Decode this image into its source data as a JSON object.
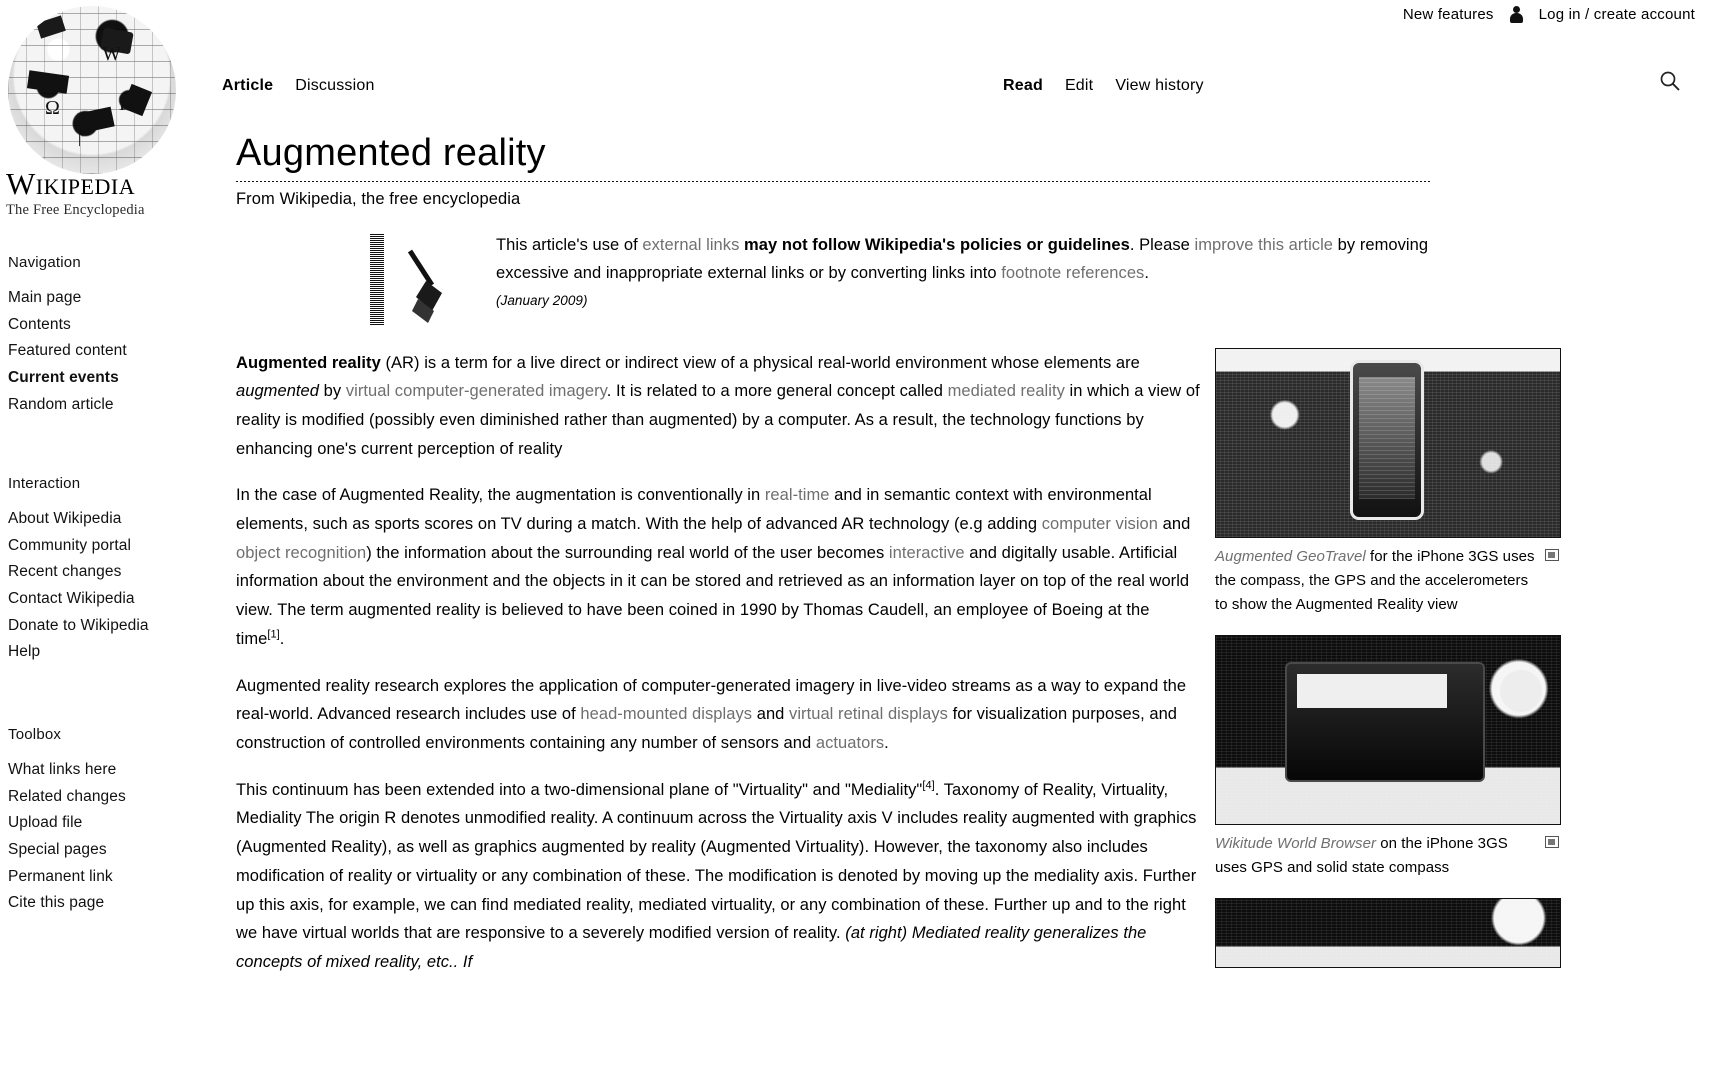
{
  "personal_bar": {
    "items": [
      {
        "label": "New features",
        "icon": null
      },
      {
        "label": "Log in / create account",
        "icon": "user-icon"
      }
    ]
  },
  "sidebar": {
    "logo_word_primary": "W",
    "logo_word_rest": "IKIPEDIA",
    "tagline": "The Free Encyclopedia",
    "sections": [
      {
        "heading": "Navigation",
        "items": [
          {
            "label": "Main page",
            "strong": false
          },
          {
            "label": "Contents",
            "strong": false
          },
          {
            "label": "Featured content",
            "strong": false
          },
          {
            "label": "Current events",
            "strong": true
          },
          {
            "label": "Random article",
            "strong": false
          }
        ]
      },
      {
        "heading": "Interaction",
        "items": [
          {
            "label": "About Wikipedia",
            "strong": false
          },
          {
            "label": "Community portal",
            "strong": false
          },
          {
            "label": "Recent changes",
            "strong": false
          },
          {
            "label": "Contact Wikipedia",
            "strong": false
          },
          {
            "label": "Donate to Wikipedia",
            "strong": false
          },
          {
            "label": "Help",
            "strong": false
          }
        ]
      },
      {
        "heading": "Toolbox",
        "items": [
          {
            "label": "What links here",
            "strong": false
          },
          {
            "label": "Related changes",
            "strong": false
          },
          {
            "label": "Upload file",
            "strong": false
          },
          {
            "label": "Special pages",
            "strong": false
          },
          {
            "label": "Permanent link",
            "strong": false
          },
          {
            "label": "Cite this page",
            "strong": false
          }
        ]
      }
    ]
  },
  "tabs": {
    "left": [
      {
        "label": "Article",
        "active": true
      },
      {
        "label": "Discussion",
        "active": false
      }
    ],
    "right": [
      {
        "label": "Read",
        "active": true
      },
      {
        "label": "Edit",
        "active": false
      },
      {
        "label": "View history",
        "active": false
      }
    ],
    "search_icon": "search-icon"
  },
  "article": {
    "title": "Augmented reality",
    "subtitle": "From Wikipedia, the free encyclopedia",
    "notice": {
      "icon": "broom-icon",
      "text_1": "This article's use of ",
      "link_1": "external links",
      "text_2": " ",
      "bold_1": "may not follow Wikipedia's policies or guidelines",
      "text_3": ". Please ",
      "link_2": "improve this article",
      "text_4": " by removing excessive and inappropriate external links or by converting links into ",
      "link_3": "footnote references",
      "text_5": ".",
      "date": "(January 2009)"
    },
    "paragraphs": [
      {
        "id": "p1",
        "runs": [
          {
            "t": "Augmented reality",
            "s": "b"
          },
          {
            "t": " (AR) is a term for a live direct or indirect view of a physical real-world environment whose elements are ",
            "s": "n"
          },
          {
            "t": "augmented",
            "s": "i"
          },
          {
            "t": " by ",
            "s": "n"
          },
          {
            "t": "virtual computer-generated imagery",
            "s": "l"
          },
          {
            "t": ". It is related to a more general concept called ",
            "s": "n"
          },
          {
            "t": "mediated reality",
            "s": "l"
          },
          {
            "t": " in which a view of reality is modified (possibly even diminished rather than augmented) by a computer. As a result, the technology functions by enhancing one's current perception of reality",
            "s": "n"
          }
        ]
      },
      {
        "id": "p2",
        "runs": [
          {
            "t": "In the case of Augmented Reality, the augmentation is conventionally in ",
            "s": "n"
          },
          {
            "t": "real-time",
            "s": "l"
          },
          {
            "t": " and in semantic context with environmental elements, such as sports scores on TV during a match. With the help of advanced AR technology (e.g  adding ",
            "s": "n"
          },
          {
            "t": "computer vision",
            "s": "l"
          },
          {
            "t": " and ",
            "s": "n"
          },
          {
            "t": "object recognition",
            "s": "l"
          },
          {
            "t": ") the information about the surrounding real world of the user becomes ",
            "s": "n"
          },
          {
            "t": "interactive",
            "s": "l"
          },
          {
            "t": " and digitally usable. Artificial information about the environment and the objects in it can be stored and retrieved as an information layer on top of the real world view. The term augmented reality is believed to have been coined in 1990 by Thomas Caudell, an employee of Boeing at the time",
            "s": "n"
          },
          {
            "t": "[1]",
            "s": "sup"
          },
          {
            "t": ".",
            "s": "n"
          }
        ]
      },
      {
        "id": "p3",
        "runs": [
          {
            "t": "Augmented reality research explores the application of computer-generated imagery in live-video streams as a way to expand the real-world. Advanced research includes use of ",
            "s": "n"
          },
          {
            "t": "head-mounted displays",
            "s": "l"
          },
          {
            "t": " and ",
            "s": "n"
          },
          {
            "t": "virtual retinal displays",
            "s": "l"
          },
          {
            "t": " for visualization purposes, and construction of controlled environments containing any number of sensors and ",
            "s": "n"
          },
          {
            "t": "actuators",
            "s": "l"
          },
          {
            "t": ".",
            "s": "n"
          }
        ]
      },
      {
        "id": "p4",
        "runs": [
          {
            "t": "This continuum has been extended into a two-dimensional plane of \"Virtuality\" and \"Mediality\"",
            "s": "n"
          },
          {
            "t": "[4]",
            "s": "sup"
          },
          {
            "t": ". Taxonomy of Reality, Virtuality, Mediality  The origin R denotes unmodified reality. A continuum across the Virtuality axis V includes reality augmented with graphics (Augmented Reality), as well as graphics augmented by reality (Augmented Virtuality). However, the taxonomy also includes modification of reality or virtuality or any combination of these. The modification is denoted by moving up the mediality axis. Further up this axis, for example, we can find mediated reality, mediated virtuality, or any combination of these. Further up and to the right we have virtual worlds that are responsive to a severely modified version of reality. ",
            "s": "n"
          },
          {
            "t": "(at right) Mediated reality generalizes the concepts of mixed reality, etc.. If",
            "s": "i"
          }
        ]
      }
    ],
    "thumbnails": [
      {
        "image_name": "augmented-geotravel-iphone-photo",
        "caption_italic": "Augmented GeoTravel",
        "caption_rest": " for the iPhone 3GS uses the compass, the GPS and the accelerometers to show the Augmented Reality view",
        "enlarge_icon": "enlarge-icon"
      },
      {
        "image_name": "wikitude-world-browser-photo",
        "caption_italic": "Wikitude World Browser",
        "caption_rest": " on the iPhone 3GS uses GPS and solid state compass",
        "enlarge_icon": "enlarge-icon"
      }
    ]
  },
  "colors": {
    "text": "#000000",
    "link_gray": "#6f6f6f",
    "background": "#ffffff"
  }
}
